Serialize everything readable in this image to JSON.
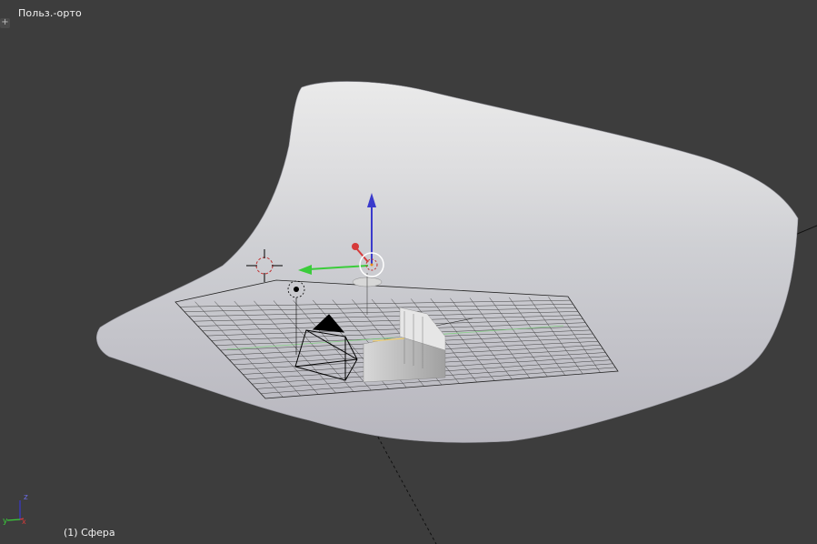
{
  "viewport": {
    "view_name": "Польз.-орто",
    "active_object": "(1) Сфера",
    "toolshelf_toggle": "+",
    "axes": {
      "x": "x",
      "y": "y",
      "z": "z"
    }
  },
  "colors": {
    "background": "#3d3d3d",
    "x_axis": "#d63a3a",
    "y_axis": "#3acc3a",
    "z_axis": "#3a3acc",
    "text": "#f2f2f2"
  }
}
